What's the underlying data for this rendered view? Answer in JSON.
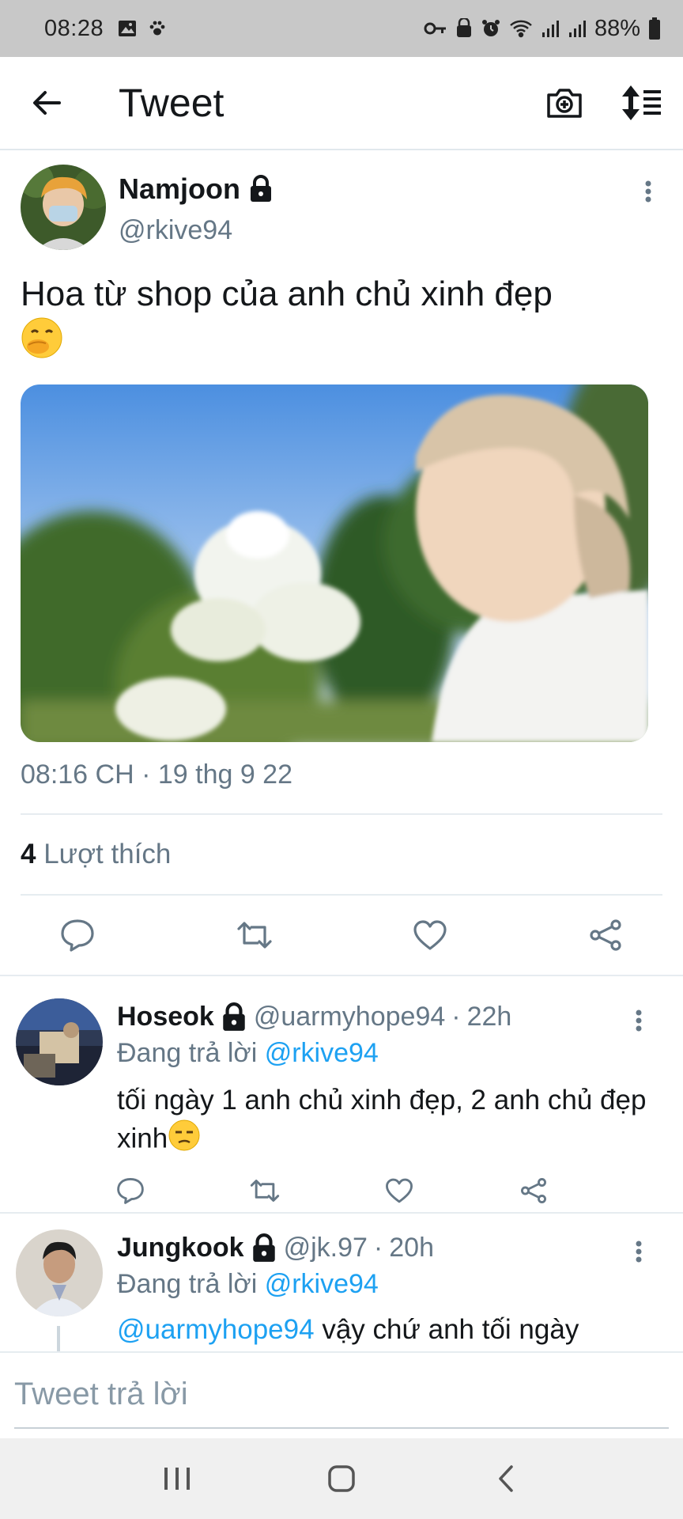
{
  "status_bar": {
    "time": "08:28",
    "battery": "88%",
    "left_icons": [
      "image-icon",
      "paw-icon"
    ],
    "right_icons": [
      "key-icon",
      "lock-bag-icon",
      "alarm-icon",
      "wifi-icon",
      "signal-icon",
      "signal-icon"
    ]
  },
  "header": {
    "title": "Tweet",
    "back_icon": "arrow-left-icon",
    "actions": [
      "camera-plus-icon",
      "sort-icon"
    ]
  },
  "tweet": {
    "author_name": "Namjoon",
    "author_handle": "@rkive94",
    "text": "Hoa từ shop của anh chủ xinh đẹp",
    "emoji": "🤭",
    "timestamp": "08:16 CH · 19 thg 9 22",
    "likes_count": "4",
    "likes_label": "Lượt thích",
    "actions": [
      "reply-icon",
      "retweet-icon",
      "like-icon",
      "share-icon"
    ]
  },
  "replies": [
    {
      "name": "Hoseok",
      "handle": "@uarmyhope94",
      "time": "22h",
      "replying_label": "Đang trả lời",
      "replying_to": "@rkive94",
      "text": "tối ngày 1 anh chủ xinh đẹp, 2 anh chủ đẹp xinh",
      "emoji": "😒"
    },
    {
      "name": "Jungkook",
      "handle": "@jk.97",
      "time": "20h",
      "replying_label": "Đang trả lời",
      "replying_to": "@rkive94",
      "text_mention": "@uarmyhope94",
      "text": "vậy chứ anh tối ngày"
    }
  ],
  "compose": {
    "placeholder": "Tweet trả lời"
  },
  "colors": {
    "accent": "#1da1f2",
    "secondary_text": "#657786",
    "status_bar_bg": "#c8c8c8"
  }
}
